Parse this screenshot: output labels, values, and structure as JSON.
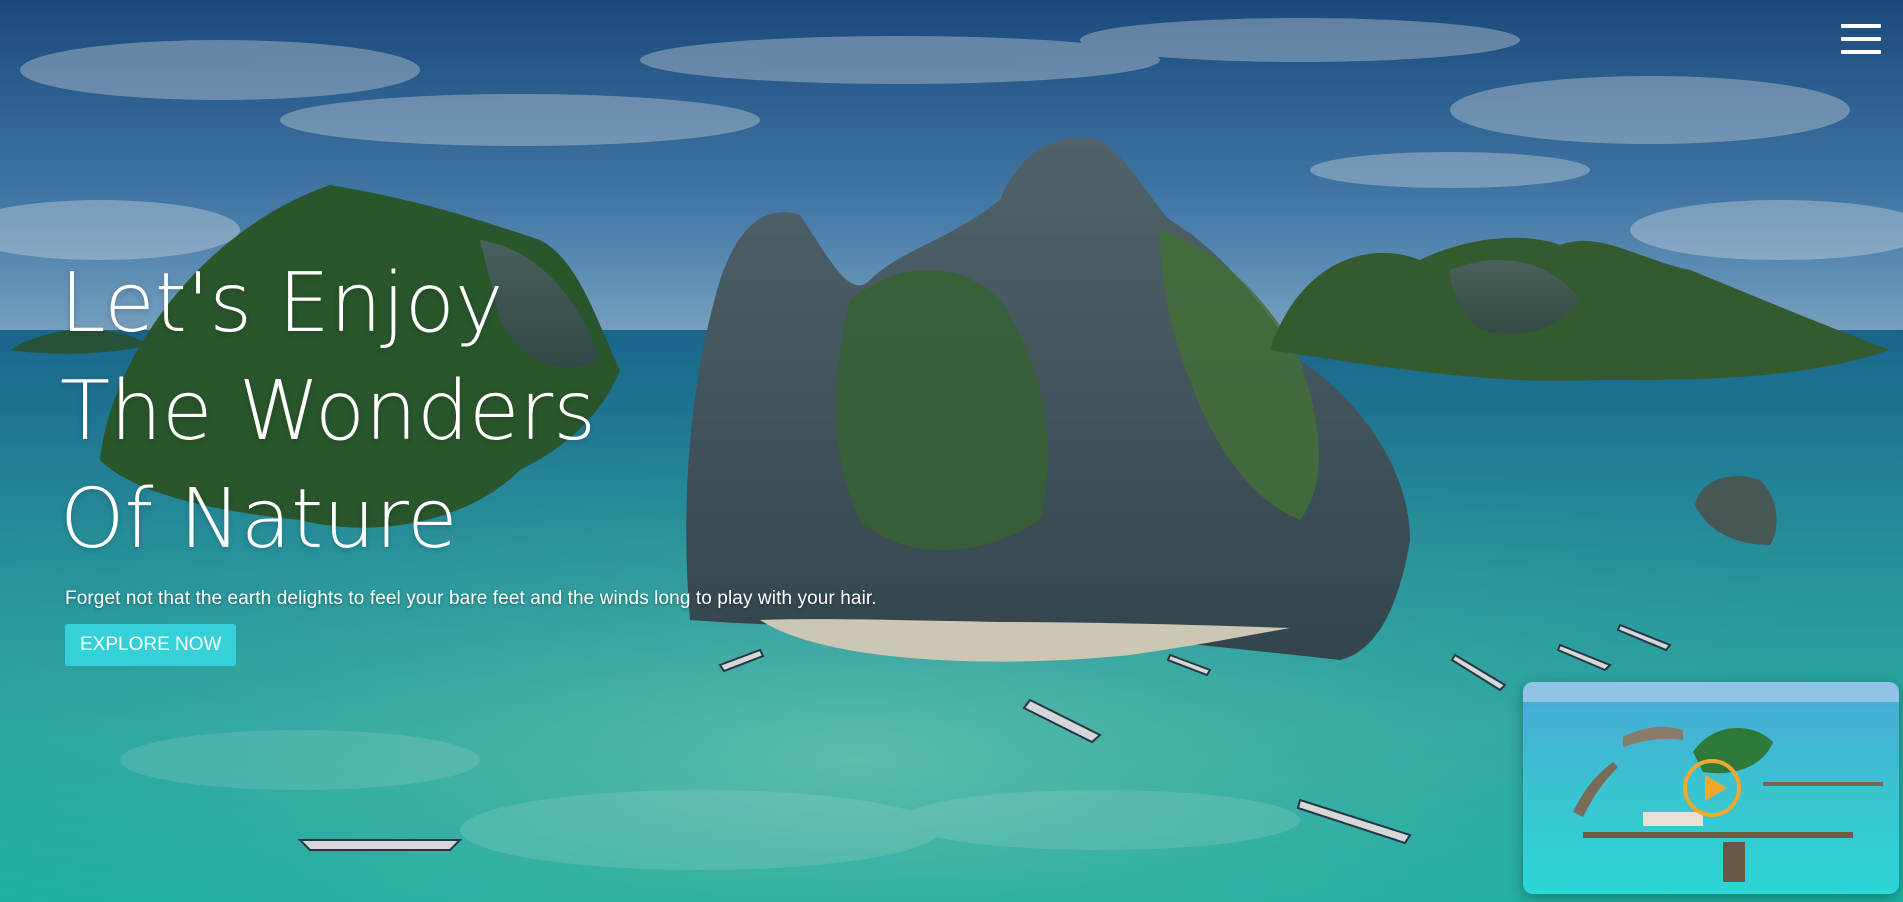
{
  "header": {
    "menu_icon": "hamburger-menu-icon"
  },
  "hero": {
    "headline": "Let's Enjoy The Wonders Of Nature",
    "subtitle": "Forget not that the earth delights to feel your bare feet and the winds long to play with your hair.",
    "cta_label": "EXPLORE NOW"
  },
  "video": {
    "play_icon": "play-icon"
  },
  "colors": {
    "accent": "#36d0d9",
    "play_ring": "#f0a830",
    "text": "#ffffff"
  }
}
